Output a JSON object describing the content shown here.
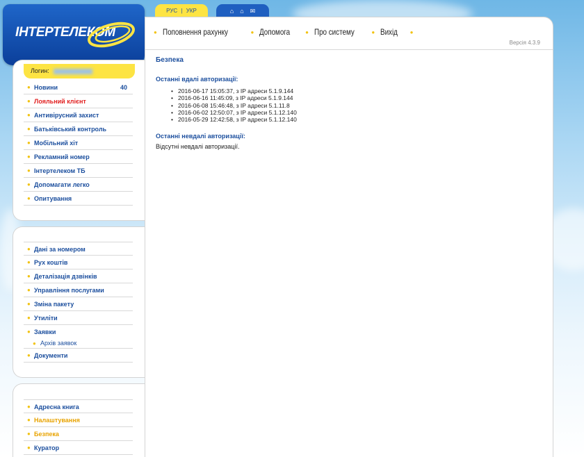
{
  "logo": {
    "text": "ІНТЕРТЕЛЕКОМ"
  },
  "login": {
    "label": "Логин:"
  },
  "language": {
    "ru": "РУС",
    "separator": "|",
    "uk": "УКР"
  },
  "top_icons": [
    "home-icon",
    "garage-icon",
    "mail-icon"
  ],
  "nav": {
    "items": [
      "Поповнення рахунку",
      "Допомога",
      "Про систему",
      "Вихід"
    ]
  },
  "version": "Версія 4.3.9",
  "sidebar": {
    "group1": [
      {
        "label": "Новини",
        "count": "40"
      },
      {
        "label": "Лояльний клієнт"
      },
      {
        "label": "Антивірусний захист"
      },
      {
        "label": "Батьківський контроль"
      },
      {
        "label": "Мобільний хіт"
      },
      {
        "label": "Рекламний номер"
      },
      {
        "label": "Інтертелеком ТБ"
      },
      {
        "label": "Допомагати легко"
      },
      {
        "label": "Опитування"
      }
    ],
    "group2": [
      {
        "label": "Дані за номером"
      },
      {
        "label": "Рух коштів"
      },
      {
        "label": "Деталізація дзвінків"
      },
      {
        "label": "Управління послугами"
      },
      {
        "label": "Зміна пакету"
      },
      {
        "label": "Утиліти"
      },
      {
        "label": "Заявки"
      },
      {
        "label": "Архів заявок"
      },
      {
        "label": "Документи"
      }
    ],
    "group3": [
      {
        "label": "Адресна книга"
      },
      {
        "label": "Налаштування"
      },
      {
        "label": "Безпека"
      },
      {
        "label": "Куратор"
      }
    ]
  },
  "main": {
    "title": "Безпека",
    "success_heading": "Останні вдалі авторизації:",
    "success_list": [
      "2016-06-17 15:05:37, з IP адреси 5.1.9.144",
      "2016-06-16 11:45:09, з IP адреси 5.1.9.144",
      "2016-06-08 15:46:48, з IP адреси 5.1.11.8",
      "2016-06-02 12:50:07, з IP адреси 5.1.12.140",
      "2016-05-29 12:42:58, з IP адреси 5.1.12.140"
    ],
    "fail_heading": "Останні невдалі авторизації:",
    "fail_text": "Відсутні невдалі авторизації."
  },
  "colors": {
    "brand_blue": "#1f5fc0",
    "brand_yellow": "#fde443",
    "link_blue": "#1c4f9e",
    "active_orange": "#e8a300",
    "highlight_red": "#e12020"
  }
}
